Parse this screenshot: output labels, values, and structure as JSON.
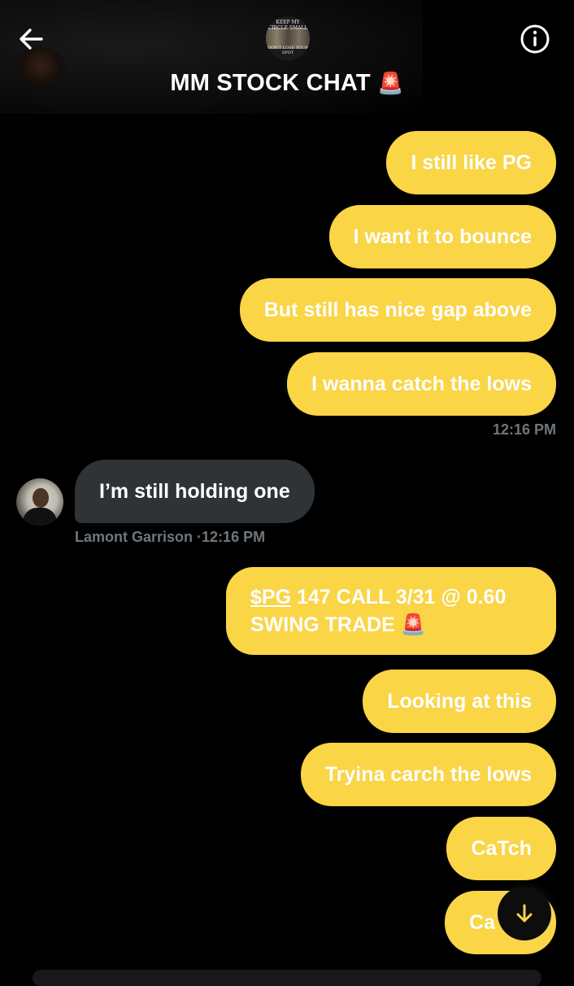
{
  "header": {
    "title": "MM STOCK CHAT",
    "title_emoji": "🚨",
    "group_avatar_text_top": "KEEP MY CIRCLE SMALL",
    "group_avatar_text_bottom": "DON'T LOSE YOUR SPOT",
    "back_icon": "arrow-left-icon",
    "info_icon": "info-icon"
  },
  "messages_block1": [
    {
      "text": "I still like PG"
    },
    {
      "text": "I want it to bounce"
    },
    {
      "text": "But still has nice gap above"
    },
    {
      "text": "I wanna catch the lows"
    }
  ],
  "timestamp1": "12:16 PM",
  "incoming": {
    "text": "I’m still holding one",
    "sender": "Lamont Garrison",
    "time": "·12:16 PM"
  },
  "trade_message": {
    "ticker": "$PG",
    "line1_rest": " 147 CALL 3/31 @ 0.60",
    "line2": "SWING TRADE",
    "emoji": "🚨"
  },
  "messages_block2": [
    {
      "text": "Looking at this"
    },
    {
      "text": "Tryina carch the lows"
    },
    {
      "text": "CaTch"
    },
    {
      "text": "Ca"
    }
  ],
  "colors": {
    "outgoing_bubble": "#fad546",
    "incoming_bubble": "#2f3336",
    "muted_text": "#6e767d",
    "background": "#000000"
  }
}
